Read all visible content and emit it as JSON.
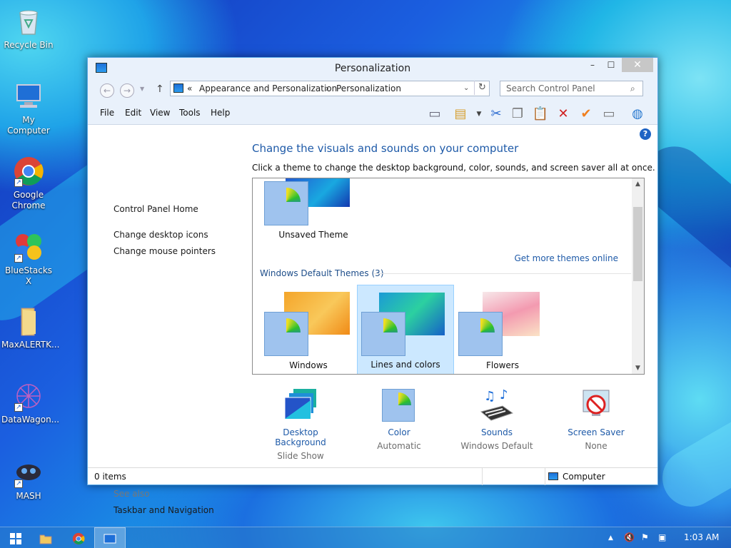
{
  "desktop": {
    "icons": [
      {
        "label": "Recycle Bin",
        "icon": "recycle-bin-icon"
      },
      {
        "label": "My Computer",
        "icon": "computer-icon"
      },
      {
        "label": "Google Chrome",
        "icon": "chrome-icon"
      },
      {
        "label": "BlueStacks X",
        "icon": "bluestacks-icon"
      },
      {
        "label": "MaxALERTK...",
        "icon": "folder-icon"
      },
      {
        "label": "DataWagon...",
        "icon": "datawagon-icon"
      },
      {
        "label": "MASH",
        "icon": "mash-icon"
      }
    ]
  },
  "window": {
    "title": "Personalization",
    "controls": {
      "minimize": "–",
      "maximize": "☐",
      "close": "✕"
    },
    "address": {
      "prefix": "«",
      "crumb1": "Appearance and Personalization",
      "separator": "›",
      "crumb2": "Personalization"
    },
    "search": {
      "placeholder": "Search Control Panel"
    },
    "menu": [
      "File",
      "Edit",
      "View",
      "Tools",
      "Help"
    ],
    "left_nav": {
      "home": "Control Panel Home",
      "links": [
        "Change desktop icons",
        "Change mouse pointers"
      ],
      "see_also_label": "See also",
      "see_also_links": [
        "Taskbar and Navigation"
      ]
    },
    "heading": "Change the visuals and sounds on your computer",
    "subtext": "Click a theme to change the desktop background, color, sounds, and screen saver all at once.",
    "themes": {
      "unsaved": {
        "name": "Unsaved Theme"
      },
      "get_more": "Get more themes online",
      "group_title": "Windows Default Themes (3)",
      "defaults": [
        {
          "name": "Windows",
          "selected": false
        },
        {
          "name": "Lines and colors",
          "selected": true
        },
        {
          "name": "Flowers",
          "selected": false
        }
      ]
    },
    "bottom_settings": [
      {
        "label": "Desktop Background",
        "value": "Slide Show",
        "icon": "desktop-background-icon"
      },
      {
        "label": "Color",
        "value": "Automatic",
        "icon": "color-icon"
      },
      {
        "label": "Sounds",
        "value": "Windows Default",
        "icon": "sounds-icon"
      },
      {
        "label": "Screen Saver",
        "value": "None",
        "icon": "screen-saver-icon"
      }
    ],
    "status": {
      "items": "0 items",
      "location": "Computer"
    }
  },
  "taskbar": {
    "clock": "1:03 AM",
    "tray_up": "▲"
  },
  "colors": {
    "link": "#1e5aa8",
    "selected_tile": "#cce8ff",
    "close_button": "#c7c7c7"
  }
}
